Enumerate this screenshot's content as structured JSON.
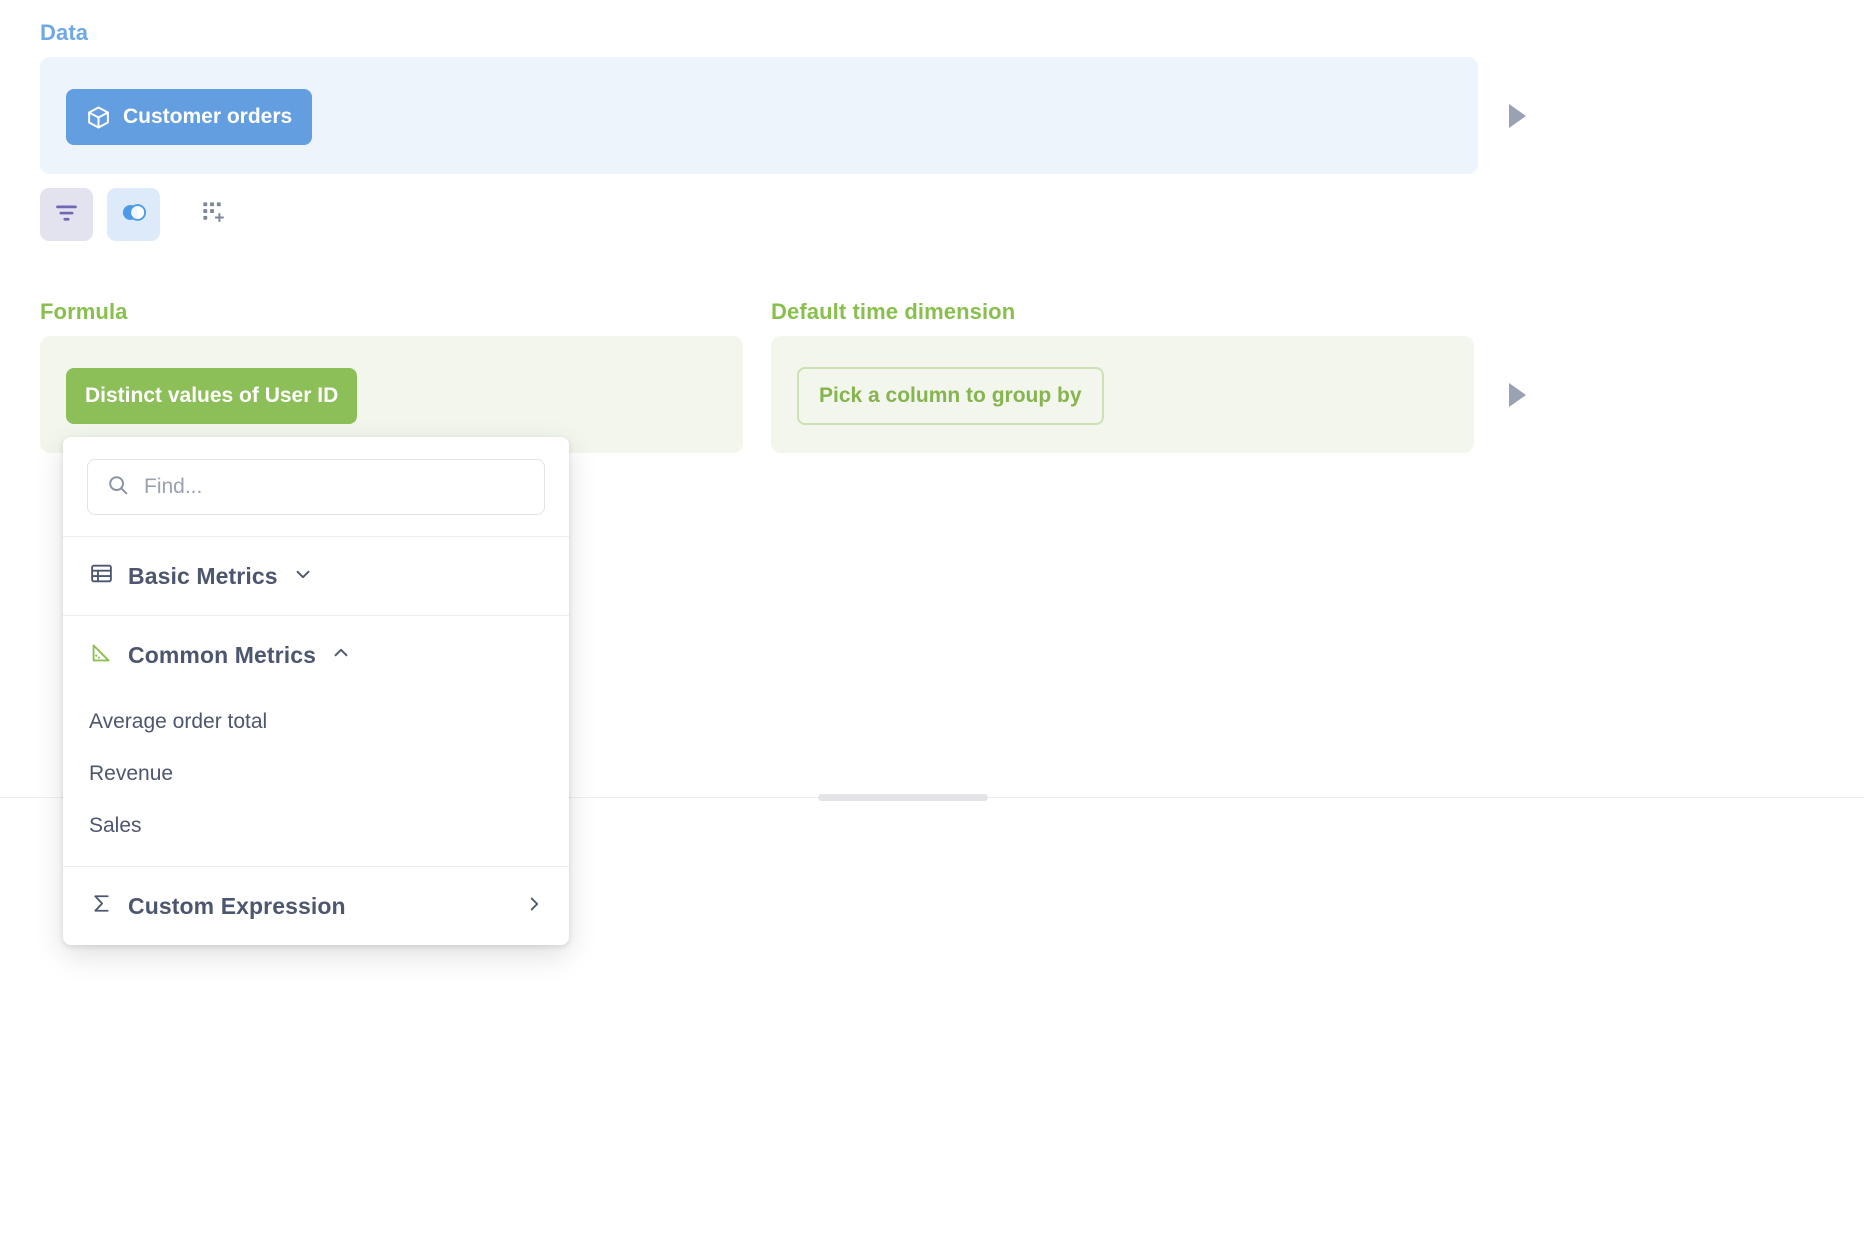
{
  "data_section": {
    "label": "Data",
    "source_chip": {
      "label": "Customer orders",
      "icon": "cube-icon",
      "color": "#629EE0"
    },
    "preview_icon": "play-triangle-icon"
  },
  "tools": [
    {
      "name": "filter",
      "icon": "filter-icon",
      "color": "#6E69B2",
      "background": "#E3E2EF",
      "active": true
    },
    {
      "name": "join",
      "icon": "join-venn-icon",
      "color": "#4C9AE8",
      "background": "#DCEAFA",
      "active": true
    },
    {
      "name": "add-column",
      "icon": "grid-plus-icon",
      "color": "#7F869A",
      "background": "transparent",
      "active": false
    }
  ],
  "formula_section": {
    "label": "Formula",
    "label_color": "#88BF4D",
    "chip": {
      "label": "Distinct values of User ID",
      "color": "#8CBF58"
    }
  },
  "time_dimension_section": {
    "label": "Default time dimension",
    "label_color": "#88BF4D",
    "chip": {
      "label": "Pick a column to group by",
      "border_color": "#CEE0B6",
      "text_color": "#86B44E"
    },
    "preview_icon": "play-triangle-icon"
  },
  "popup": {
    "search": {
      "placeholder": "Find...",
      "value": "",
      "icon": "search-icon"
    },
    "groups": [
      {
        "title": "Basic Metrics",
        "icon": "table-icon",
        "icon_color": "#4C566F",
        "chevron": "chevron-down-icon",
        "expanded": false,
        "items": []
      },
      {
        "title": "Common Metrics",
        "icon": "ruler-triangle-icon",
        "icon_color": "#8CBF58",
        "chevron": "chevron-up-icon",
        "expanded": true,
        "items": [
          "Average order total",
          "Revenue",
          "Sales"
        ]
      }
    ],
    "custom_expression": {
      "title": "Custom Expression",
      "icon": "sigma-icon",
      "chevron": "chevron-right-icon"
    }
  }
}
